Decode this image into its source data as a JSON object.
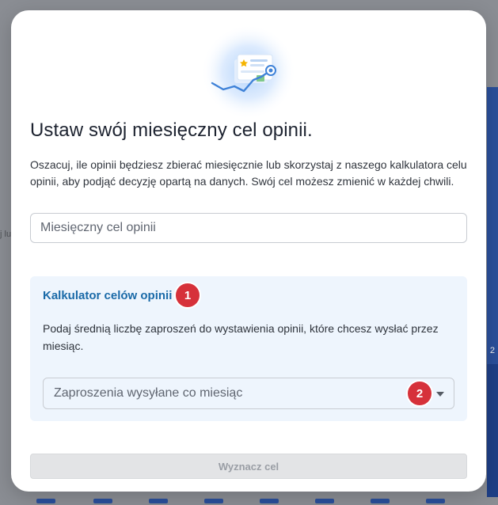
{
  "modal": {
    "title": "Ustaw swój miesięczny cel opinii.",
    "description": "Oszacuj, ile opinii będziesz zbierać miesięcznie lub skorzystaj z naszego kalkulatora celu opinii, aby podjąć decyzję opartą na danych. Swój cel możesz zmienić w każdej chwili.",
    "goal_input": {
      "placeholder": "Miesięczny cel opinii",
      "value": ""
    },
    "calculator": {
      "heading": "Kalkulator celów opinii",
      "badge": "1",
      "text": "Podaj średnią liczbę zaproszeń do wystawienia opinii, które chcesz wysłać przez miesiąc.",
      "select": {
        "placeholder": "Zaproszenia wysyłane co miesiąc",
        "badge": "2",
        "icon": "chevron-down-icon"
      }
    },
    "submit_label": "Wyznacz cel",
    "illustration_icon": "review-chart-illustration"
  },
  "background": {
    "left_fragment": "j lu",
    "right_fragment": "2"
  },
  "colors": {
    "accent": "#1a6aa8",
    "badge": "#d6313a",
    "panel": "#eef5fd",
    "overlay": "#8a8d93"
  }
}
